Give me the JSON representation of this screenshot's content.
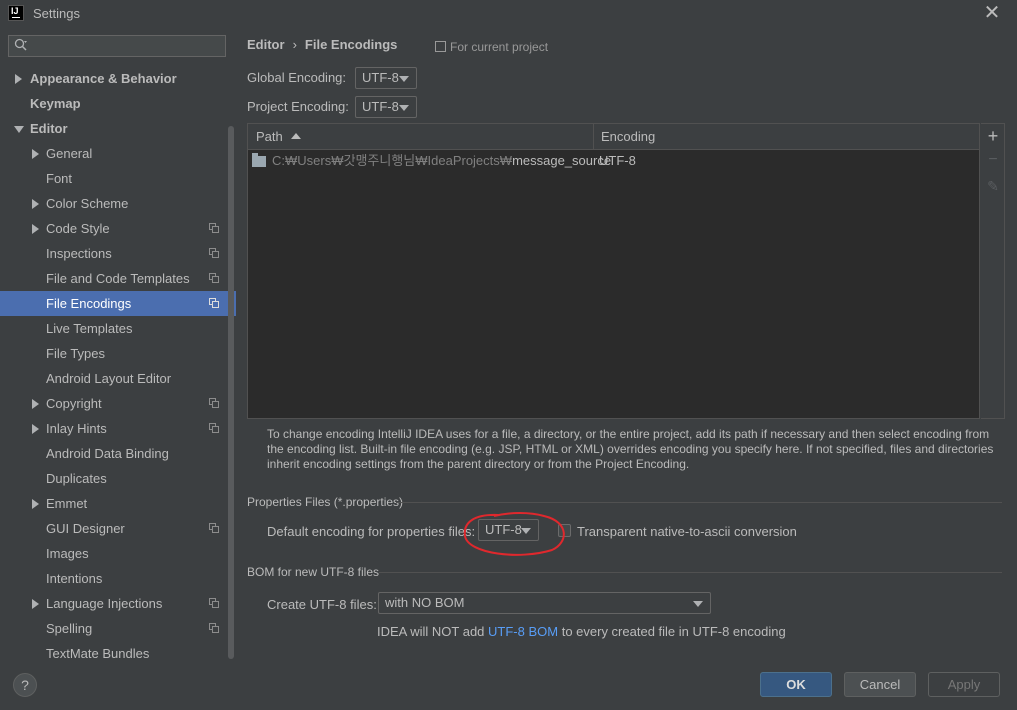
{
  "window": {
    "title": "Settings",
    "app_icon_text": "IJ",
    "close_glyph": "✕"
  },
  "search": {
    "placeholder": "",
    "value": ""
  },
  "tree": [
    {
      "label": "Appearance & Behavior",
      "level": 0,
      "bold": true,
      "expander": "right"
    },
    {
      "label": "Keymap",
      "level": 0,
      "bold": true,
      "expander": "none"
    },
    {
      "label": "Editor",
      "level": 0,
      "bold": true,
      "expander": "down"
    },
    {
      "label": "General",
      "level": 1,
      "expander": "right"
    },
    {
      "label": "Font",
      "level": 1,
      "expander": "none"
    },
    {
      "label": "Color Scheme",
      "level": 1,
      "expander": "right"
    },
    {
      "label": "Code Style",
      "level": 1,
      "expander": "right",
      "project_icon": true
    },
    {
      "label": "Inspections",
      "level": 1,
      "expander": "none",
      "project_icon": true
    },
    {
      "label": "File and Code Templates",
      "level": 1,
      "expander": "none",
      "project_icon": true
    },
    {
      "label": "File Encodings",
      "level": 1,
      "expander": "none",
      "project_icon": true,
      "selected": true
    },
    {
      "label": "Live Templates",
      "level": 1,
      "expander": "none"
    },
    {
      "label": "File Types",
      "level": 1,
      "expander": "none"
    },
    {
      "label": "Android Layout Editor",
      "level": 1,
      "expander": "none"
    },
    {
      "label": "Copyright",
      "level": 1,
      "expander": "right",
      "project_icon": true
    },
    {
      "label": "Inlay Hints",
      "level": 1,
      "expander": "right",
      "project_icon": true
    },
    {
      "label": "Android Data Binding",
      "level": 1,
      "expander": "none"
    },
    {
      "label": "Duplicates",
      "level": 1,
      "expander": "none"
    },
    {
      "label": "Emmet",
      "level": 1,
      "expander": "right"
    },
    {
      "label": "GUI Designer",
      "level": 1,
      "expander": "none",
      "project_icon": true
    },
    {
      "label": "Images",
      "level": 1,
      "expander": "none"
    },
    {
      "label": "Intentions",
      "level": 1,
      "expander": "none"
    },
    {
      "label": "Language Injections",
      "level": 1,
      "expander": "right",
      "project_icon": true
    },
    {
      "label": "Spelling",
      "level": 1,
      "expander": "none",
      "project_icon": true
    },
    {
      "label": "TextMate Bundles",
      "level": 1,
      "expander": "none"
    }
  ],
  "header": {
    "crumb_parent": "Editor",
    "crumb_sep": "›",
    "crumb_current": "File Encodings",
    "scope_label": "For current project"
  },
  "encoding": {
    "global_label": "Global Encoding:",
    "global_value": "UTF-8",
    "project_label": "Project Encoding:",
    "project_value": "UTF-8"
  },
  "table": {
    "col_path": "Path",
    "col_encoding": "Encoding",
    "rows": [
      {
        "path_prefix": "C:₩Users₩갓맹주니행님₩IdeaProjects₩",
        "path_name": "message_source",
        "encoding": "UTF-8"
      }
    ],
    "tools": {
      "add": "+",
      "remove": "−",
      "edit": "✎"
    }
  },
  "info_text": "To change encoding IntelliJ IDEA uses for a file, a directory, or the entire project, add its path if necessary and then select encoding from the encoding list. Built-in file encoding (e.g. JSP, HTML or XML) overrides encoding you specify here. If not specified, files and directories inherit encoding settings from the parent directory or from the Project Encoding.",
  "properties": {
    "group_title": "Properties Files (*.properties)",
    "default_label": "Default encoding for properties files:",
    "default_value": "UTF-8",
    "transparent_label": "Transparent native-to-ascii conversion",
    "transparent_checked": false
  },
  "bom": {
    "group_title": "BOM for new UTF-8 files",
    "create_label": "Create UTF-8 files:",
    "create_value": "with NO BOM",
    "note_before": "IDEA will NOT add ",
    "note_link": "UTF-8 BOM",
    "note_after": " to every created file in UTF-8 encoding"
  },
  "buttons": {
    "help": "?",
    "ok": "OK",
    "cancel": "Cancel",
    "apply": "Apply"
  },
  "colors": {
    "selection": "#4b6eaf",
    "link": "#589df6",
    "annotation": "#e0282d"
  }
}
